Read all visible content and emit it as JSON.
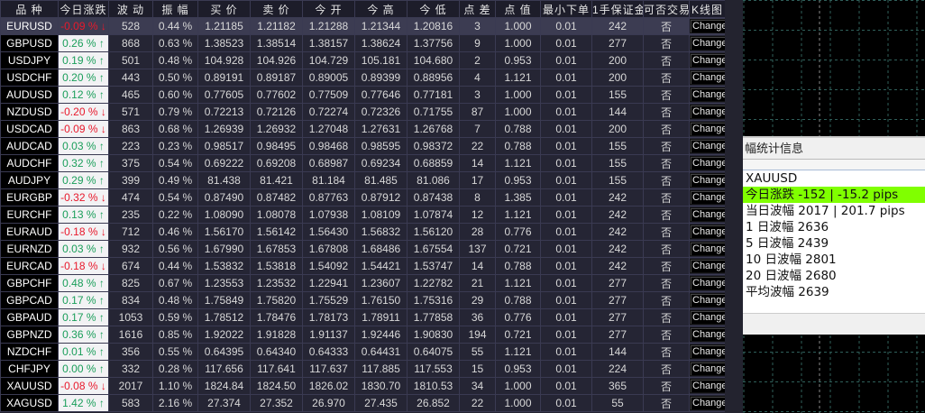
{
  "table": {
    "columns": [
      "品 种",
      "今日涨跌",
      "波 动",
      "振 幅",
      "买 价",
      "卖 价",
      "今 开",
      "今 高",
      "今 低",
      "点 差",
      "点 值",
      "最小下单",
      "1手保证金",
      "可否交易",
      "K线图"
    ],
    "selected_row": 0,
    "rows": [
      {
        "symbol": "EURUSD",
        "change": "-0.09 %",
        "dir": "down",
        "vol": "528",
        "amp": "0.44 %",
        "bid": "1.21185",
        "ask": "1.21182",
        "open": "1.21288",
        "high": "1.21344",
        "low": "1.20816",
        "spread": "3",
        "pv": "1.000",
        "min": "0.01",
        "margin": "242",
        "trade": "否",
        "btn": "Change"
      },
      {
        "symbol": "GBPUSD",
        "change": "0.26 %",
        "dir": "up",
        "vol": "868",
        "amp": "0.63 %",
        "bid": "1.38523",
        "ask": "1.38514",
        "open": "1.38157",
        "high": "1.38624",
        "low": "1.37756",
        "spread": "9",
        "pv": "1.000",
        "min": "0.01",
        "margin": "277",
        "trade": "否",
        "btn": "Change"
      },
      {
        "symbol": "USDJPY",
        "change": "0.19 %",
        "dir": "up",
        "vol": "501",
        "amp": "0.48 %",
        "bid": "104.928",
        "ask": "104.926",
        "open": "104.729",
        "high": "105.181",
        "low": "104.680",
        "spread": "2",
        "pv": "0.953",
        "min": "0.01",
        "margin": "200",
        "trade": "否",
        "btn": "Change"
      },
      {
        "symbol": "USDCHF",
        "change": "0.20 %",
        "dir": "up",
        "vol": "443",
        "amp": "0.50 %",
        "bid": "0.89191",
        "ask": "0.89187",
        "open": "0.89005",
        "high": "0.89399",
        "low": "0.88956",
        "spread": "4",
        "pv": "1.121",
        "min": "0.01",
        "margin": "200",
        "trade": "否",
        "btn": "Change"
      },
      {
        "symbol": "AUDUSD",
        "change": "0.12 %",
        "dir": "up",
        "vol": "465",
        "amp": "0.60 %",
        "bid": "0.77605",
        "ask": "0.77602",
        "open": "0.77509",
        "high": "0.77646",
        "low": "0.77181",
        "spread": "3",
        "pv": "1.000",
        "min": "0.01",
        "margin": "155",
        "trade": "否",
        "btn": "Change"
      },
      {
        "symbol": "NZDUSD",
        "change": "-0.20 %",
        "dir": "down",
        "vol": "571",
        "amp": "0.79 %",
        "bid": "0.72213",
        "ask": "0.72126",
        "open": "0.72274",
        "high": "0.72326",
        "low": "0.71755",
        "spread": "87",
        "pv": "1.000",
        "min": "0.01",
        "margin": "144",
        "trade": "否",
        "btn": "Change"
      },
      {
        "symbol": "USDCAD",
        "change": "-0.09 %",
        "dir": "down",
        "vol": "863",
        "amp": "0.68 %",
        "bid": "1.26939",
        "ask": "1.26932",
        "open": "1.27048",
        "high": "1.27631",
        "low": "1.26768",
        "spread": "7",
        "pv": "0.788",
        "min": "0.01",
        "margin": "200",
        "trade": "否",
        "btn": "Change"
      },
      {
        "symbol": "AUDCAD",
        "change": "0.03 %",
        "dir": "up",
        "vol": "223",
        "amp": "0.23 %",
        "bid": "0.98517",
        "ask": "0.98495",
        "open": "0.98468",
        "high": "0.98595",
        "low": "0.98372",
        "spread": "22",
        "pv": "0.788",
        "min": "0.01",
        "margin": "155",
        "trade": "否",
        "btn": "Change"
      },
      {
        "symbol": "AUDCHF",
        "change": "0.32 %",
        "dir": "up",
        "vol": "375",
        "amp": "0.54 %",
        "bid": "0.69222",
        "ask": "0.69208",
        "open": "0.68987",
        "high": "0.69234",
        "low": "0.68859",
        "spread": "14",
        "pv": "1.121",
        "min": "0.01",
        "margin": "155",
        "trade": "否",
        "btn": "Change"
      },
      {
        "symbol": "AUDJPY",
        "change": "0.29 %",
        "dir": "up",
        "vol": "399",
        "amp": "0.49 %",
        "bid": "81.438",
        "ask": "81.421",
        "open": "81.184",
        "high": "81.485",
        "low": "81.086",
        "spread": "17",
        "pv": "0.953",
        "min": "0.01",
        "margin": "155",
        "trade": "否",
        "btn": "Change"
      },
      {
        "symbol": "EURGBP",
        "change": "-0.32 %",
        "dir": "down",
        "vol": "474",
        "amp": "0.54 %",
        "bid": "0.87490",
        "ask": "0.87482",
        "open": "0.87763",
        "high": "0.87912",
        "low": "0.87438",
        "spread": "8",
        "pv": "1.385",
        "min": "0.01",
        "margin": "242",
        "trade": "否",
        "btn": "Change"
      },
      {
        "symbol": "EURCHF",
        "change": "0.13 %",
        "dir": "up",
        "vol": "235",
        "amp": "0.22 %",
        "bid": "1.08090",
        "ask": "1.08078",
        "open": "1.07938",
        "high": "1.08109",
        "low": "1.07874",
        "spread": "12",
        "pv": "1.121",
        "min": "0.01",
        "margin": "242",
        "trade": "否",
        "btn": "Change"
      },
      {
        "symbol": "EURAUD",
        "change": "-0.18 %",
        "dir": "down",
        "vol": "712",
        "amp": "0.46 %",
        "bid": "1.56170",
        "ask": "1.56142",
        "open": "1.56430",
        "high": "1.56832",
        "low": "1.56120",
        "spread": "28",
        "pv": "0.776",
        "min": "0.01",
        "margin": "242",
        "trade": "否",
        "btn": "Change"
      },
      {
        "symbol": "EURNZD",
        "change": "0.03 %",
        "dir": "up",
        "vol": "932",
        "amp": "0.56 %",
        "bid": "1.67990",
        "ask": "1.67853",
        "open": "1.67808",
        "high": "1.68486",
        "low": "1.67554",
        "spread": "137",
        "pv": "0.721",
        "min": "0.01",
        "margin": "242",
        "trade": "否",
        "btn": "Change"
      },
      {
        "symbol": "EURCAD",
        "change": "-0.18 %",
        "dir": "down",
        "vol": "674",
        "amp": "0.44 %",
        "bid": "1.53832",
        "ask": "1.53818",
        "open": "1.54092",
        "high": "1.54421",
        "low": "1.53747",
        "spread": "14",
        "pv": "0.788",
        "min": "0.01",
        "margin": "242",
        "trade": "否",
        "btn": "Change"
      },
      {
        "symbol": "GBPCHF",
        "change": "0.48 %",
        "dir": "up",
        "vol": "825",
        "amp": "0.67 %",
        "bid": "1.23553",
        "ask": "1.23532",
        "open": "1.22941",
        "high": "1.23607",
        "low": "1.22782",
        "spread": "21",
        "pv": "1.121",
        "min": "0.01",
        "margin": "277",
        "trade": "否",
        "btn": "Change"
      },
      {
        "symbol": "GBPCAD",
        "change": "0.17 %",
        "dir": "up",
        "vol": "834",
        "amp": "0.48 %",
        "bid": "1.75849",
        "ask": "1.75820",
        "open": "1.75529",
        "high": "1.76150",
        "low": "1.75316",
        "spread": "29",
        "pv": "0.788",
        "min": "0.01",
        "margin": "277",
        "trade": "否",
        "btn": "Change"
      },
      {
        "symbol": "GBPAUD",
        "change": "0.17 %",
        "dir": "up",
        "vol": "1053",
        "amp": "0.59 %",
        "bid": "1.78512",
        "ask": "1.78476",
        "open": "1.78173",
        "high": "1.78911",
        "low": "1.77858",
        "spread": "36",
        "pv": "0.776",
        "min": "0.01",
        "margin": "277",
        "trade": "否",
        "btn": "Change"
      },
      {
        "symbol": "GBPNZD",
        "change": "0.36 %",
        "dir": "up",
        "vol": "1616",
        "amp": "0.85 %",
        "bid": "1.92022",
        "ask": "1.91828",
        "open": "1.91137",
        "high": "1.92446",
        "low": "1.90830",
        "spread": "194",
        "pv": "0.721",
        "min": "0.01",
        "margin": "277",
        "trade": "否",
        "btn": "Change"
      },
      {
        "symbol": "NZDCHF",
        "change": "0.01 %",
        "dir": "up",
        "vol": "356",
        "amp": "0.55 %",
        "bid": "0.64395",
        "ask": "0.64340",
        "open": "0.64333",
        "high": "0.64431",
        "low": "0.64075",
        "spread": "55",
        "pv": "1.121",
        "min": "0.01",
        "margin": "144",
        "trade": "否",
        "btn": "Change"
      },
      {
        "symbol": "CHFJPY",
        "change": "0.00 %",
        "dir": "up",
        "vol": "332",
        "amp": "0.28 %",
        "bid": "117.656",
        "ask": "117.641",
        "open": "117.637",
        "high": "117.885",
        "low": "117.553",
        "spread": "15",
        "pv": "0.953",
        "min": "0.01",
        "margin": "224",
        "trade": "否",
        "btn": "Change"
      },
      {
        "symbol": "XAUUSD",
        "change": "-0.08 %",
        "dir": "down",
        "vol": "2017",
        "amp": "1.10 %",
        "bid": "1824.84",
        "ask": "1824.50",
        "open": "1826.02",
        "high": "1830.70",
        "low": "1810.53",
        "spread": "34",
        "pv": "1.000",
        "min": "0.01",
        "margin": "365",
        "trade": "否",
        "btn": "Change"
      },
      {
        "symbol": "XAGUSD",
        "change": "1.42 %",
        "dir": "up",
        "vol": "583",
        "amp": "2.16 %",
        "bid": "27.374",
        "ask": "27.352",
        "open": "26.970",
        "high": "27.435",
        "low": "26.852",
        "spread": "22",
        "pv": "1.000",
        "min": "0.01",
        "margin": "55",
        "trade": "否",
        "btn": "Change"
      }
    ]
  },
  "arrows": {
    "up": "↑",
    "down": "↓"
  },
  "colors": {
    "up": "#1a9e5a",
    "down": "#e8192c",
    "price": "#1f9a3c",
    "spread": "#ffff00",
    "highlight": "#80ff00",
    "grid": "#2f5f5a"
  },
  "panel": {
    "title": "幅统计信息",
    "lines": [
      "XAUUSD",
      "今日涨跌 -152 | -15.2 pips",
      "当日波幅 2017 | 201.7 pips",
      "1 日波幅 2636",
      "5 日波幅 2439",
      "10 日波幅 2801",
      "20 日波幅 2680",
      "平均波幅 2639"
    ],
    "highlight_line": 1
  }
}
